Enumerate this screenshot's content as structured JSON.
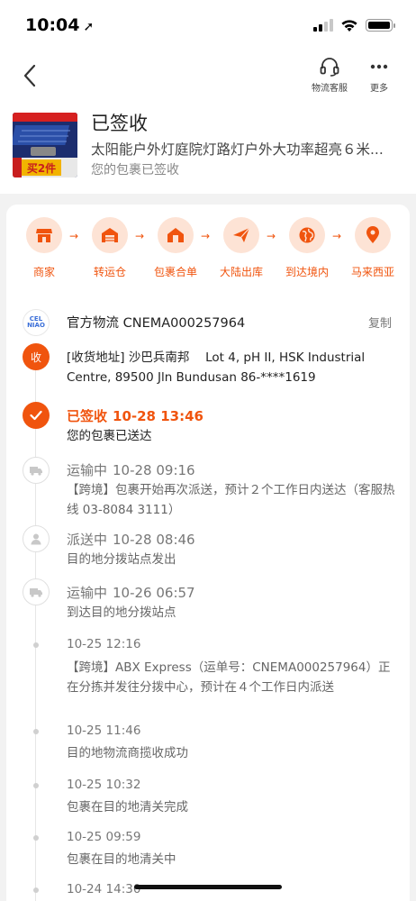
{
  "status_bar": {
    "time": "10:04"
  },
  "nav": {
    "service_label": "物流客服",
    "more_label": "更多"
  },
  "header": {
    "status": "已签收",
    "product_name": "太阳能户外灯庭院灯路灯户外大功率超亮６米...",
    "sub_status": "您的包裹已签收",
    "thumb_badge": "买2件"
  },
  "steps": [
    {
      "label": "商家",
      "icon": "shop-icon"
    },
    {
      "label": "转运仓",
      "icon": "warehouse-icon"
    },
    {
      "label": "包裹合单",
      "icon": "package-merge-icon"
    },
    {
      "label": "大陆出库",
      "icon": "plane-icon"
    },
    {
      "label": "到达境内",
      "icon": "globe-icon"
    },
    {
      "label": "马来西亚",
      "icon": "location-pin-icon"
    }
  ],
  "carrier": {
    "logo_text": "CEL\nNIAO",
    "text": "官方物流 CNEMA000257964",
    "copy_label": "复制"
  },
  "address": {
    "icon_label": "收",
    "text": "[收货地址] 沙巴兵南邦　 Lot 4, pH II, HSK Industrial Centre, 89500 Jln Bundusan 86-****1619"
  },
  "events": [
    {
      "status": "已签收",
      "time": "10-28 13:46",
      "desc": "您的包裹已送达"
    },
    {
      "status": "运输中",
      "time": "10-28 09:16",
      "desc": "【跨境】包裹开始再次派送，预计２个工作日内送达（客服热线 03-8084 3111）"
    },
    {
      "status": "派送中",
      "time": "10-28 08:46",
      "desc": "目的地分拨站点发出"
    },
    {
      "status": "运输中",
      "time": "10-26 06:57",
      "desc": "到达目的地分拨站点"
    },
    {
      "time": "10-25 12:16",
      "desc": "【跨境】ABX Express（运单号：CNEMA000257964）正在分拣并发往分拨中心，预计在４个工作日内派送"
    },
    {
      "time": "10-25 11:46",
      "desc": "目的地物流商揽收成功"
    },
    {
      "time": "10-25 10:32",
      "desc": "包裹在目的地清关完成"
    },
    {
      "time": "10-25 09:59",
      "desc": "包裹在目的地清关中"
    },
    {
      "time": "10-24 14:30"
    }
  ],
  "colors": {
    "accent": "#f0540e",
    "accent_light": "#fde3d5"
  }
}
